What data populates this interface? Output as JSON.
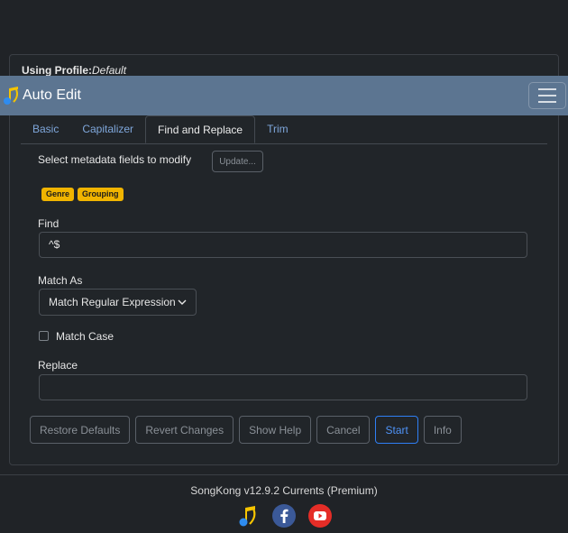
{
  "profile": {
    "label": "Using Profile:",
    "name": "Default"
  },
  "app": {
    "title": "Auto Edit"
  },
  "tabs": [
    {
      "label": "Basic",
      "active": false
    },
    {
      "label": "Capitalizer",
      "active": false
    },
    {
      "label": "Find and Replace",
      "active": true
    },
    {
      "label": "Trim",
      "active": false
    }
  ],
  "fields": {
    "select_label": "Select metadata fields to modify",
    "update_label": "Update...",
    "badges": [
      "Genre",
      "Grouping"
    ]
  },
  "find": {
    "label": "Find",
    "value": "^$"
  },
  "match": {
    "label": "Match As",
    "selected": "Match Regular Expression"
  },
  "match_case": {
    "label": "Match Case",
    "checked": false
  },
  "replace": {
    "label": "Replace",
    "value": ""
  },
  "buttons": {
    "restore": "Restore Defaults",
    "revert": "Revert Changes",
    "help": "Show Help",
    "cancel": "Cancel",
    "start": "Start",
    "info": "Info"
  },
  "footer": {
    "version": "SongKong v12.9.2 Currents (Premium)"
  },
  "colors": {
    "accent": "#2f7ff5",
    "navbar": "#5c7591",
    "badge": "#f0b400"
  }
}
